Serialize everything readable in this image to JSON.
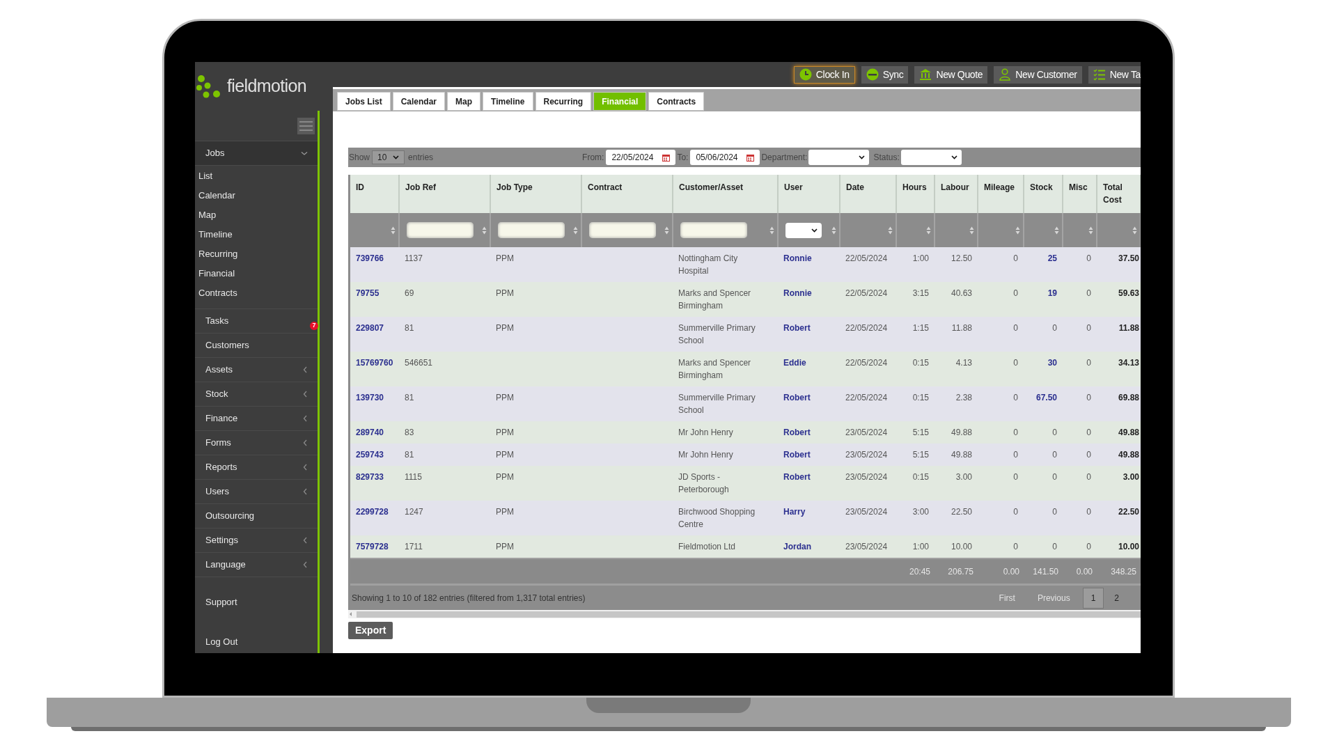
{
  "logo": {
    "text": "fieldmotion"
  },
  "toolbar": [
    {
      "label": "Clock In",
      "kind": "clock",
      "active": true
    },
    {
      "label": "Sync",
      "kind": "sync",
      "active": false
    },
    {
      "label": "New Quote",
      "kind": "bank",
      "active": false
    },
    {
      "label": "New Customer",
      "kind": "person",
      "active": false
    },
    {
      "label": "New Ta",
      "kind": "checklist",
      "active": false
    }
  ],
  "sidebar": {
    "items": [
      {
        "label": "Jobs",
        "expanded": true,
        "has_submenu": true,
        "children": [
          {
            "label": "List"
          },
          {
            "label": "Calendar"
          },
          {
            "label": "Map"
          },
          {
            "label": "Timeline"
          },
          {
            "label": "Recurring"
          },
          {
            "label": "Financial"
          },
          {
            "label": "Contracts"
          }
        ]
      },
      {
        "label": "Tasks",
        "has_submenu": false,
        "badge": "7"
      },
      {
        "label": "Customers",
        "has_submenu": false
      },
      {
        "label": "Assets",
        "has_submenu": true,
        "expanded": false
      },
      {
        "label": "Stock",
        "has_submenu": true,
        "expanded": false
      },
      {
        "label": "Finance",
        "has_submenu": true,
        "expanded": false
      },
      {
        "label": "Forms",
        "has_submenu": true,
        "expanded": false
      },
      {
        "label": "Reports",
        "has_submenu": true,
        "expanded": false
      },
      {
        "label": "Users",
        "has_submenu": true,
        "expanded": false
      },
      {
        "label": "Outsourcing",
        "has_submenu": false
      },
      {
        "label": "Settings",
        "has_submenu": true,
        "expanded": false
      },
      {
        "label": "Language",
        "has_submenu": true,
        "expanded": false
      }
    ],
    "footer_links": [
      {
        "label": "Support"
      },
      {
        "label": "Log Out"
      }
    ]
  },
  "tabs": [
    {
      "label": "Jobs List",
      "selected": false
    },
    {
      "label": "Calendar",
      "selected": false
    },
    {
      "label": "Map",
      "selected": false
    },
    {
      "label": "Timeline",
      "selected": false
    },
    {
      "label": "Recurring",
      "selected": false
    },
    {
      "label": "Financial",
      "selected": true
    },
    {
      "label": "Contracts",
      "selected": false
    }
  ],
  "controls": {
    "show_label": "Show",
    "page_size": "10",
    "entries_label": "entries",
    "from_label": "From:",
    "from_date": "22/05/2024",
    "to_label": "To:",
    "to_date": "05/06/2024",
    "department_label": "Department:",
    "status_label": "Status:"
  },
  "table": {
    "columns": [
      {
        "label": "ID",
        "kind": "plain"
      },
      {
        "label": "Job Ref",
        "kind": "text"
      },
      {
        "label": "Job Type",
        "kind": "text"
      },
      {
        "label": "Contract",
        "kind": "text"
      },
      {
        "label": "Customer/Asset",
        "kind": "text"
      },
      {
        "label": "User",
        "kind": "select"
      },
      {
        "label": "Date",
        "kind": "plain"
      },
      {
        "label": "Hours",
        "kind": "plain"
      },
      {
        "label": "Labour",
        "kind": "plain"
      },
      {
        "label": "Mileage",
        "kind": "plain"
      },
      {
        "label": "Stock",
        "kind": "plain"
      },
      {
        "label": "Misc",
        "kind": "plain"
      },
      {
        "label": "Total Cost",
        "kind": "plain"
      }
    ],
    "rows": [
      {
        "id": "739766",
        "job_ref": "1137",
        "job_type": "PPM",
        "customer": "Nottingham City Hospital",
        "user": "Ronnie",
        "date": "22/05/2024",
        "hours": "1:00",
        "labour": "12.50",
        "mileage": "0",
        "stock": "25",
        "stock_linked": true,
        "misc": "0",
        "total_cost": "37.50"
      },
      {
        "id": "79755",
        "job_ref": "69",
        "job_type": "PPM",
        "customer": "Marks and Spencer Birmingham",
        "user": "Ronnie",
        "date": "22/05/2024",
        "hours": "3:15",
        "labour": "40.63",
        "mileage": "0",
        "stock": "19",
        "stock_linked": true,
        "misc": "0",
        "total_cost": "59.63"
      },
      {
        "id": "229807",
        "job_ref": "81",
        "job_type": "PPM",
        "customer": "Summerville Primary School",
        "user": "Robert",
        "date": "22/05/2024",
        "hours": "1:15",
        "labour": "11.88",
        "mileage": "0",
        "stock": "0",
        "stock_linked": false,
        "misc": "0",
        "total_cost": "11.88"
      },
      {
        "id": "15769760",
        "job_ref": "546651",
        "customer": "Marks and Spencer Birmingham",
        "user": "Eddie",
        "date": "22/05/2024",
        "hours": "0:15",
        "labour": "4.13",
        "mileage": "0",
        "stock": "30",
        "stock_linked": true,
        "misc": "0",
        "total_cost": "34.13"
      },
      {
        "id": "139730",
        "job_ref": "81",
        "job_type": "PPM",
        "customer": "Summerville Primary School",
        "user": "Robert",
        "date": "22/05/2024",
        "hours": "0:15",
        "labour": "2.38",
        "mileage": "0",
        "stock": "67.50",
        "stock_linked": true,
        "misc": "0",
        "total_cost": "69.88"
      },
      {
        "id": "289740",
        "job_ref": "83",
        "job_type": "PPM",
        "customer": "Mr John Henry",
        "user": "Robert",
        "date": "23/05/2024",
        "hours": "5:15",
        "labour": "49.88",
        "mileage": "0",
        "stock": "0",
        "stock_linked": false,
        "misc": "0",
        "total_cost": "49.88"
      },
      {
        "id": "259743",
        "job_ref": "81",
        "job_type": "PPM",
        "customer": "Mr John Henry",
        "user": "Robert",
        "date": "23/05/2024",
        "hours": "5:15",
        "labour": "49.88",
        "mileage": "0",
        "stock": "0",
        "stock_linked": false,
        "misc": "0",
        "total_cost": "49.88"
      },
      {
        "id": "829733",
        "job_ref": "1115",
        "job_type": "PPM",
        "customer": "JD Sports - Peterborough",
        "user": "Robert",
        "date": "23/05/2024",
        "hours": "0:15",
        "labour": "3.00",
        "mileage": "0",
        "stock": "0",
        "stock_linked": false,
        "misc": "0",
        "total_cost": "3.00"
      },
      {
        "id": "2299728",
        "job_ref": "1247",
        "job_type": "PPM",
        "customer": "Birchwood Shopping Centre",
        "user": "Harry",
        "date": "23/05/2024",
        "hours": "3:00",
        "labour": "22.50",
        "mileage": "0",
        "stock": "0",
        "stock_linked": false,
        "misc": "0",
        "total_cost": "22.50"
      },
      {
        "id": "7579728",
        "job_ref": "1711",
        "job_type": "PPM",
        "customer": "Fieldmotion Ltd",
        "user": "Jordan",
        "date": "23/05/2024",
        "hours": "1:00",
        "labour": "10.00",
        "mileage": "0",
        "stock": "0",
        "stock_linked": false,
        "misc": "0",
        "total_cost": "10.00"
      }
    ],
    "totals": {
      "hours": "20:45",
      "labour": "206.75",
      "mileage": "0.00",
      "stock": "141.50",
      "misc": "0.00",
      "total_cost": "348.25"
    }
  },
  "footer": {
    "info": "Showing 1 to 10 of 182 entries (filtered from 1,317 total entries)",
    "pagination": [
      {
        "label": "First",
        "kind": "nav",
        "disabled": true,
        "selected": false
      },
      {
        "label": "Previous",
        "kind": "nav",
        "disabled": true,
        "selected": false
      },
      {
        "label": "1",
        "kind": "page",
        "disabled": false,
        "selected": true
      },
      {
        "label": "2",
        "kind": "page",
        "disabled": false,
        "selected": false
      }
    ]
  },
  "export_button": {
    "label": "Export"
  }
}
